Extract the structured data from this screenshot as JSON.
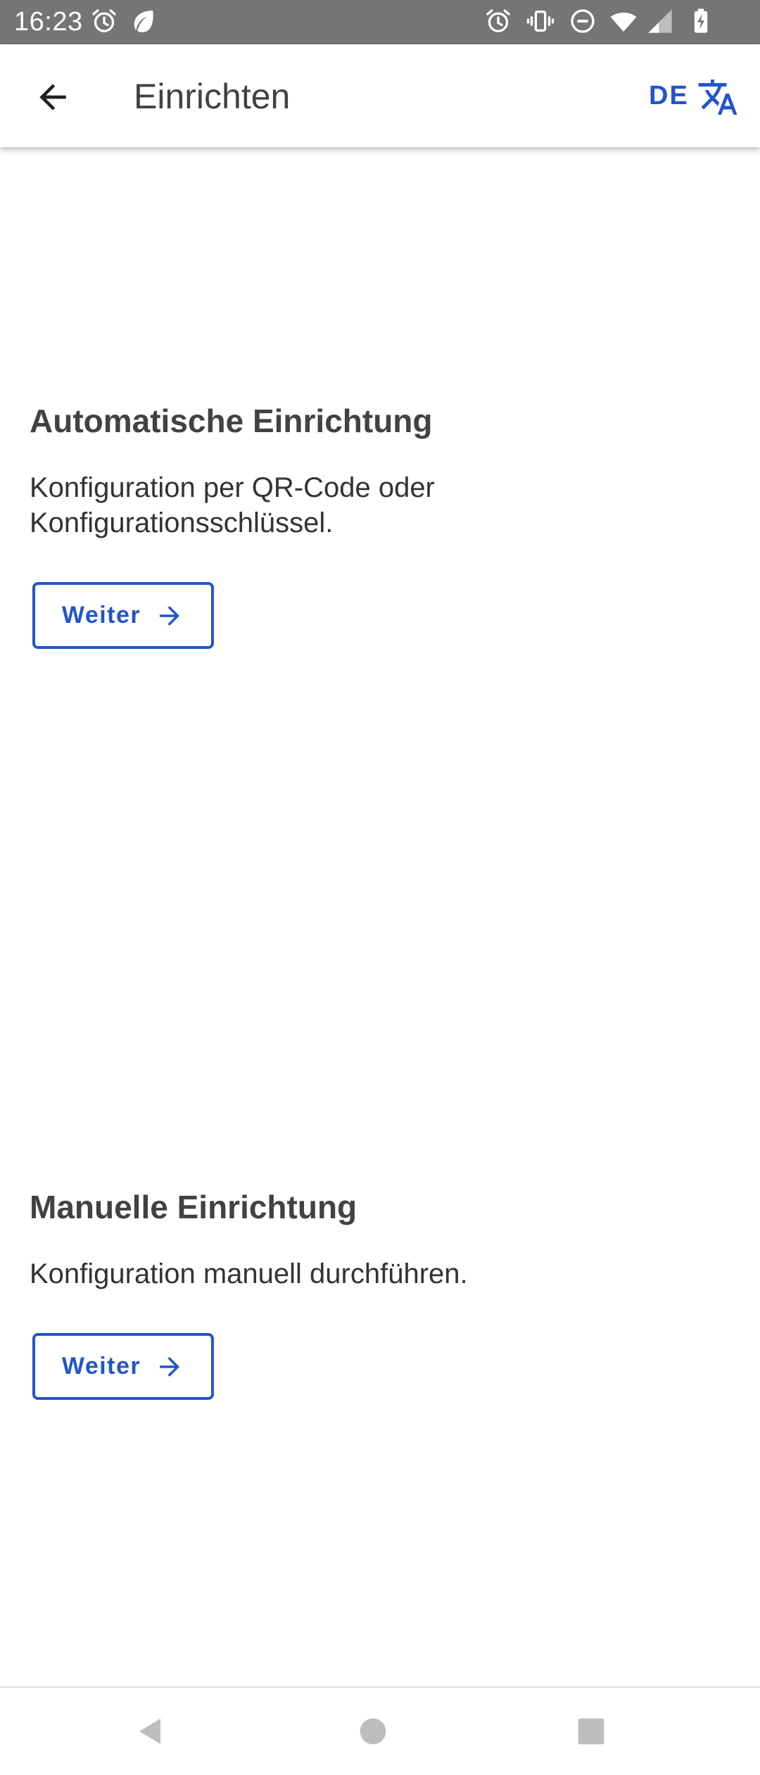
{
  "status_bar": {
    "time": "16:23",
    "left_icons": [
      "alarm-icon",
      "leaf-icon"
    ],
    "right_icons": [
      "alarm-icon",
      "vibrate-icon",
      "do-not-disturb-icon",
      "wifi-icon",
      "signal-icon",
      "battery-charging-icon"
    ],
    "background": "#757575"
  },
  "app_bar": {
    "back_icon": "arrow-back-icon",
    "title": "Einrichten",
    "language": "DE",
    "translate_icon": "translate-icon"
  },
  "sections": [
    {
      "title": "Automatische Einrichtung",
      "description_lines": [
        "Konfiguration per QR-Code oder",
        "Konfigurationsschlüssel."
      ],
      "button_label": "Weiter"
    },
    {
      "title": "Manuelle Einrichtung",
      "description": "Konfiguration manuell durchführen.",
      "button_label": "Weiter"
    }
  ],
  "nav_bar": {
    "back_icon": "nav-back-icon",
    "home_icon": "nav-home-icon",
    "recents_icon": "nav-recents-icon"
  },
  "colors": {
    "accent": "#2255cc",
    "title_text": "#424242",
    "body_text": "#333333"
  }
}
